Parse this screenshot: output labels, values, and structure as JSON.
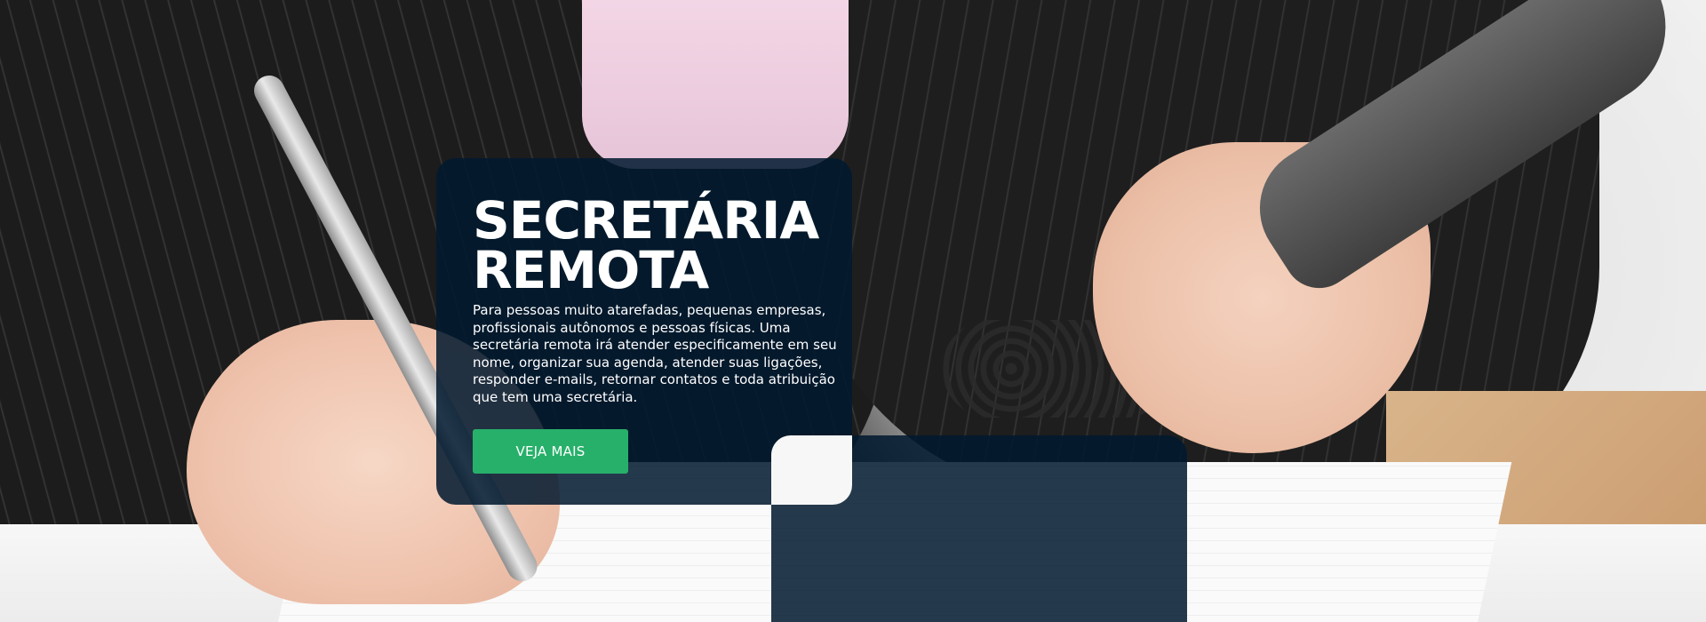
{
  "hero": {
    "title_line1": "SECRETÁRIA",
    "title_line2": "REMOTA",
    "description": "Para pessoas muito atarefadas, pequenas empresas, profissionais autônomos e pessoas físicas. Uma secretária remota irá atender especificamente em seu nome, organizar sua agenda, atender suas ligações, responder e-mails, retornar contatos e toda atribuição que tem uma secretária.",
    "cta_label": "VEJA MAIS"
  },
  "colors": {
    "panel": "#00182e",
    "cta": "#27b06a",
    "text": "#ffffff"
  }
}
